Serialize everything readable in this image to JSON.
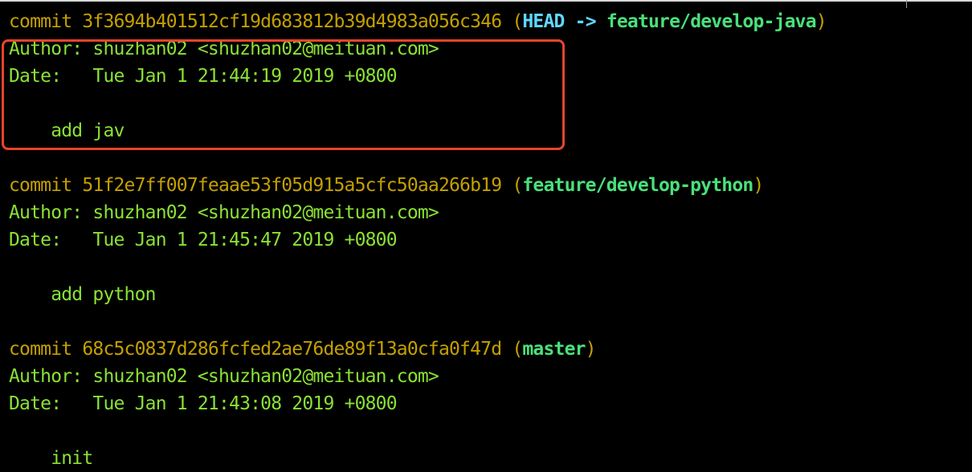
{
  "commits": [
    {
      "commit_label": "commit",
      "hash": "3f3694b401512cf19d683812b39d4983a056c346",
      "ref_open": "(",
      "head": "HEAD",
      "arrow": "->",
      "branch": "feature/develop-java",
      "ref_close": ")",
      "author_label": "Author:",
      "author": "shuzhan02 <shuzhan02@meituan.com>",
      "date_label": "Date:",
      "date": "Tue Jan 1 21:44:19 2019 +0800",
      "message": "add jav"
    },
    {
      "commit_label": "commit",
      "hash": "51f2e7ff007feaae53f05d915a5cfc50aa266b19",
      "ref_open": "(",
      "branch": "feature/develop-python",
      "ref_close": ")",
      "author_label": "Author:",
      "author": "shuzhan02 <shuzhan02@meituan.com>",
      "date_label": "Date:",
      "date": "Tue Jan 1 21:45:47 2019 +0800",
      "message": "add python"
    },
    {
      "commit_label": "commit",
      "hash": "68c5c0837d286fcfed2ae76de89f13a0cfa0f47d",
      "ref_open": "(",
      "branch": "master",
      "ref_close": ")",
      "author_label": "Author:",
      "author": "shuzhan02 <shuzhan02@meituan.com>",
      "date_label": "Date:",
      "date": "Tue Jan 1 21:43:08 2019 +0800",
      "message": "init"
    }
  ],
  "colors": {
    "background": "#000000",
    "commit_text": "#c4a000",
    "body_text": "#8ae234",
    "branch": "#4ae07a",
    "head": "#5fd7ff",
    "highlight_border": "#e8442b"
  }
}
